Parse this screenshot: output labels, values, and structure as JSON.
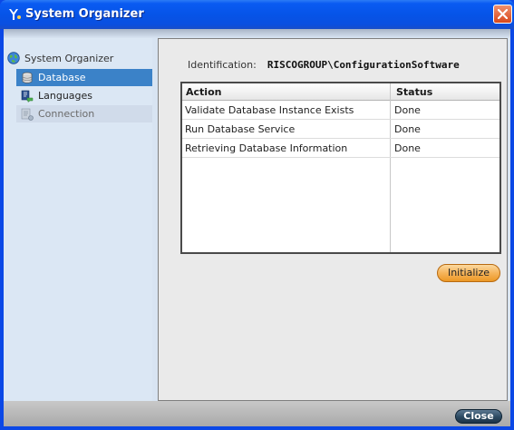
{
  "window": {
    "title": "System Organizer",
    "close_label": "Close"
  },
  "sidebar": {
    "root_label": "System Organizer",
    "items": [
      {
        "label": "Database",
        "icon": "database-icon",
        "state": "selected"
      },
      {
        "label": "Languages",
        "icon": "languages-icon",
        "state": "normal"
      },
      {
        "label": "Connection",
        "icon": "connection-icon",
        "state": "disabled"
      }
    ]
  },
  "main": {
    "identification_label": "Identification:",
    "identification_value": "RISCOGROUP\\ConfigurationSoftware",
    "table": {
      "columns": [
        "Action",
        "Status"
      ],
      "rows": [
        {
          "action": "Validate Database Instance Exists",
          "status": "Done"
        },
        {
          "action": "Run Database Service",
          "status": "Done"
        },
        {
          "action": "Retrieving Database Information",
          "status": "Done"
        }
      ]
    },
    "initialize_label": "Initialize"
  },
  "colors": {
    "titlebar": "#0654e8",
    "selection": "#3b82c8",
    "initialize_button": "#f6b45a",
    "close_button": "#2c4a62"
  }
}
